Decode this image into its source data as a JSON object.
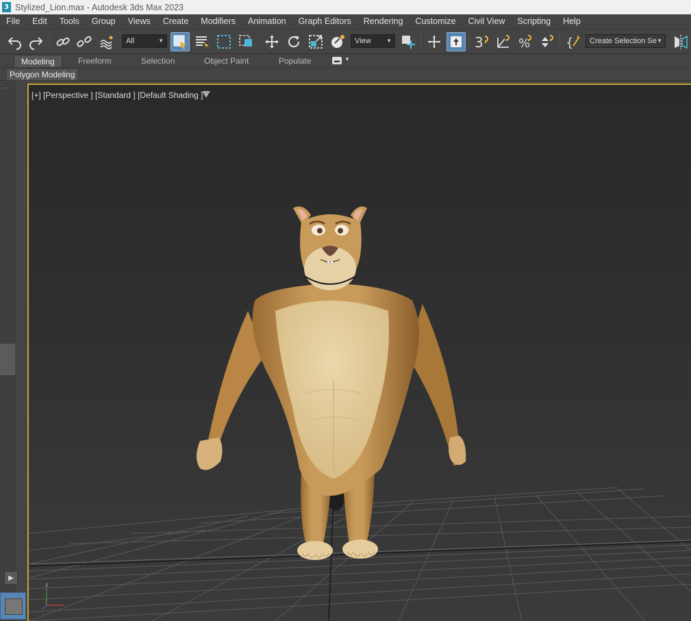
{
  "window": {
    "app_icon_text": "3",
    "title": "Stylized_Lion.max - Autodesk 3ds Max 2023"
  },
  "menu": [
    "File",
    "Edit",
    "Tools",
    "Group",
    "Views",
    "Create",
    "Modifiers",
    "Animation",
    "Graph Editors",
    "Rendering",
    "Customize",
    "Civil View",
    "Scripting",
    "Help"
  ],
  "toolbar": {
    "selection_filter": "All",
    "reference_coord": "View",
    "named_selection": "Create Selection Se",
    "snap_value": "3"
  },
  "ribbon": {
    "tabs": [
      "Modeling",
      "Freeform",
      "Selection",
      "Object Paint",
      "Populate"
    ],
    "active_tab": "Modeling",
    "panel": "Polygon Modeling"
  },
  "viewport": {
    "label": "[+] [Perspective ] [Standard ] [Default Shading ]",
    "object": "Stylized lion character",
    "colors": {
      "active_border": "#c8a431",
      "fur": "#c89a5a",
      "belly": "#e2cda0",
      "grid": "#5a5a5a"
    }
  },
  "icons": [
    "undo-icon",
    "redo-icon",
    "link-icon",
    "unlink-icon",
    "bind-space-warp-icon",
    "select-object-icon",
    "select-by-name-icon",
    "rect-region-icon",
    "window-crossing-icon",
    "move-icon",
    "rotate-icon",
    "scale-icon",
    "placement-icon",
    "pivot-icon",
    "manipulate-icon",
    "keyboard-shortcut-icon",
    "snaps-toggle-icon",
    "angle-snap-icon",
    "percent-snap-icon",
    "spinner-snap-icon",
    "edit-named-selection-icon",
    "mirror-icon",
    "filter-icon",
    "play-icon",
    "axis-tripod-icon"
  ]
}
